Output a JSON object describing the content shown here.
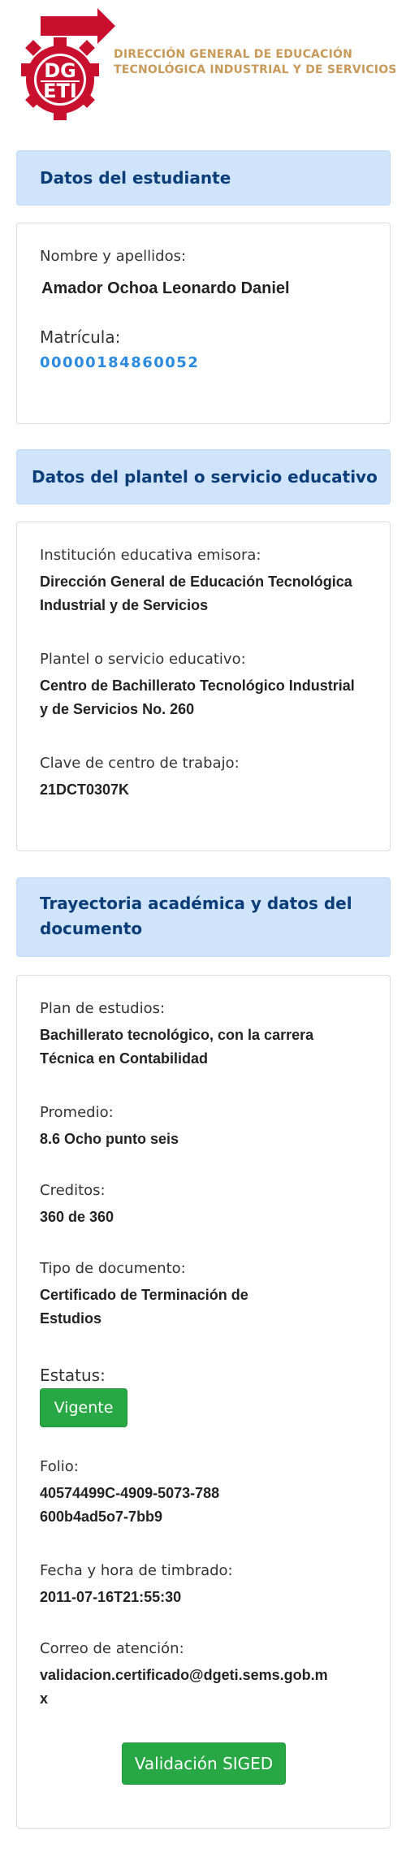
{
  "brand": {
    "logo_text": "DGETI",
    "org_line1": "DIRECCIÓN GENERAL DE EDUCACIÓN",
    "org_line2": "TECNOLÓGICA INDUSTRIAL Y DE SERVICIOS",
    "colors": {
      "logo_red": "#c8102e",
      "org_gold": "#c89a5a"
    }
  },
  "student": {
    "section_title": "Datos del estudiante",
    "name_label": "Nombre y apellidos:",
    "name_value": "Amador Ochoa Leonardo Daniel",
    "matricula_label": "Matrícula:",
    "matricula_value": "00000184860052"
  },
  "school": {
    "section_title": "Datos del plantel o servicio educativo",
    "institution_label": "Institución educativa emisora:",
    "institution_value": "Dirección General de Educación Tecnológica Industrial y de Servicios",
    "campus_label": "Plantel o servicio educativo:",
    "campus_value": "Centro de Bachillerato Tecnológico Industrial y de Servicios No. 260",
    "key_label": "Clave de centro de trabajo:",
    "key_value": "21DCT0307K"
  },
  "academic": {
    "section_title": "Trayectoria académica y datos del documento",
    "plan_label": "Plan de estudios:",
    "plan_value": "Bachillerato tecnológico, con la carrera Técnica en Contabilidad",
    "avg_label": "Promedio:",
    "avg_value": "8.6 Ocho punto seis",
    "credits_label": "Creditos:",
    "credits_value": "360 de 360",
    "doc_type_label": "Tipo de documento:",
    "doc_type_value": "Certificado de Terminación de Estudios",
    "status_label": "Estatus:",
    "status_value": "Vigente",
    "folio_label": "Folio:",
    "folio_value": "40574499C-4909-5073-788600b4ad5o7-7bb9",
    "stamp_label": "Fecha y hora de timbrado:",
    "stamp_value": "2011-07-16T21:55:30",
    "email_label": "Correo de atención:",
    "email_value": "validacion.certificado@dgeti.sems.gob.mx",
    "validate_button": "Validación SIGED"
  }
}
